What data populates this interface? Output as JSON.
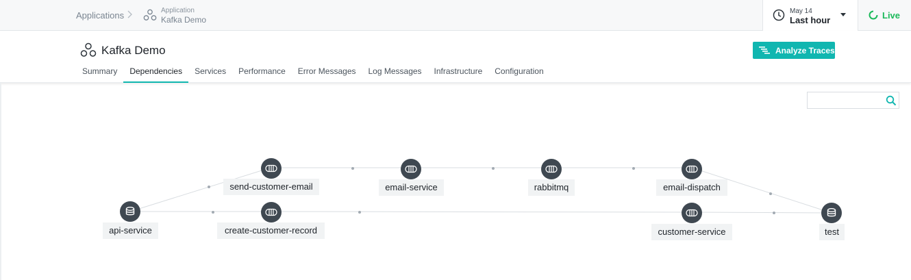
{
  "breadcrumb": {
    "applications": "Applications",
    "separator": ">",
    "app_kind": "Application",
    "app_name": "Kafka Demo"
  },
  "time_picker": {
    "date": "May 14",
    "range": "Last hour",
    "icon": "clock-icon"
  },
  "live": {
    "label": "Live",
    "color": "#1bb95a"
  },
  "header": {
    "title": "Kafka Demo",
    "analyze_label": "Analyze Traces",
    "accent": "#10b6b0"
  },
  "tabs": [
    {
      "label": "Summary"
    },
    {
      "label": "Dependencies",
      "active": true
    },
    {
      "label": "Services"
    },
    {
      "label": "Performance"
    },
    {
      "label": "Error Messages"
    },
    {
      "label": "Log Messages"
    },
    {
      "label": "Infrastructure"
    },
    {
      "label": "Configuration"
    }
  ],
  "search": {
    "value": "",
    "placeholder": ""
  },
  "graph": {
    "nodes": {
      "api_service": {
        "label": "api-service",
        "type": "database"
      },
      "send_customer_email": {
        "label": "send-customer-email",
        "type": "queue"
      },
      "create_customer_record": {
        "label": "create-customer-record",
        "type": "queue"
      },
      "email_service": {
        "label": "email-service",
        "type": "queue"
      },
      "rabbitmq": {
        "label": "rabbitmq",
        "type": "queue"
      },
      "email_dispatch": {
        "label": "email-dispatch",
        "type": "queue"
      },
      "customer_service": {
        "label": "customer-service",
        "type": "queue"
      },
      "test": {
        "label": "test",
        "type": "database"
      }
    }
  }
}
